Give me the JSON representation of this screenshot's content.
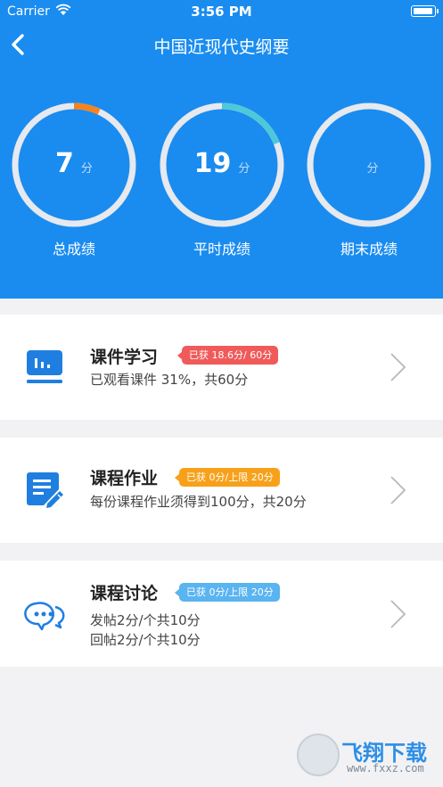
{
  "status_bar": {
    "carrier": "Carrier",
    "time": "3:56 PM"
  },
  "nav": {
    "title": "中国近现代史纲要"
  },
  "scores": [
    {
      "value": "7",
      "unit": "分",
      "label": "总成绩",
      "progress_color": "#f5831f",
      "progress_fraction": 0.07
    },
    {
      "value": "19",
      "unit": "分",
      "label": "平时成绩",
      "progress_color": "#4ec8d8",
      "progress_fraction": 0.19
    },
    {
      "value": "",
      "unit": "分",
      "label": "期末成绩",
      "progress_color": "#4ec8d8",
      "progress_fraction": 0
    }
  ],
  "cards": [
    {
      "title": "课件学习",
      "badge": "已获 18.6分/ 60分",
      "badge_color": "#f05a5a",
      "desc": [
        "已观看课件 31%，共60分"
      ],
      "icon": "courseware-icon"
    },
    {
      "title": "课程作业",
      "badge": "已获 0分/上限 20分",
      "badge_color": "#f7a11b",
      "desc": [
        "每份课程作业须得到100分，共20分"
      ],
      "icon": "homework-icon"
    },
    {
      "title": "课程讨论",
      "badge": "已获 0分/上限 20分",
      "badge_color": "#5ab4f0",
      "desc": [
        "发帖2分/个共10分",
        "回帖2分/个共10分"
      ],
      "icon": "discussion-icon"
    }
  ],
  "watermark": {
    "main": "飞翔下载",
    "sub": "www.fxxz.com"
  },
  "colors": {
    "header_bg": "#1a8cf0",
    "icon_blue": "#1f7fe0",
    "ring_track": "#e6e9ee"
  }
}
